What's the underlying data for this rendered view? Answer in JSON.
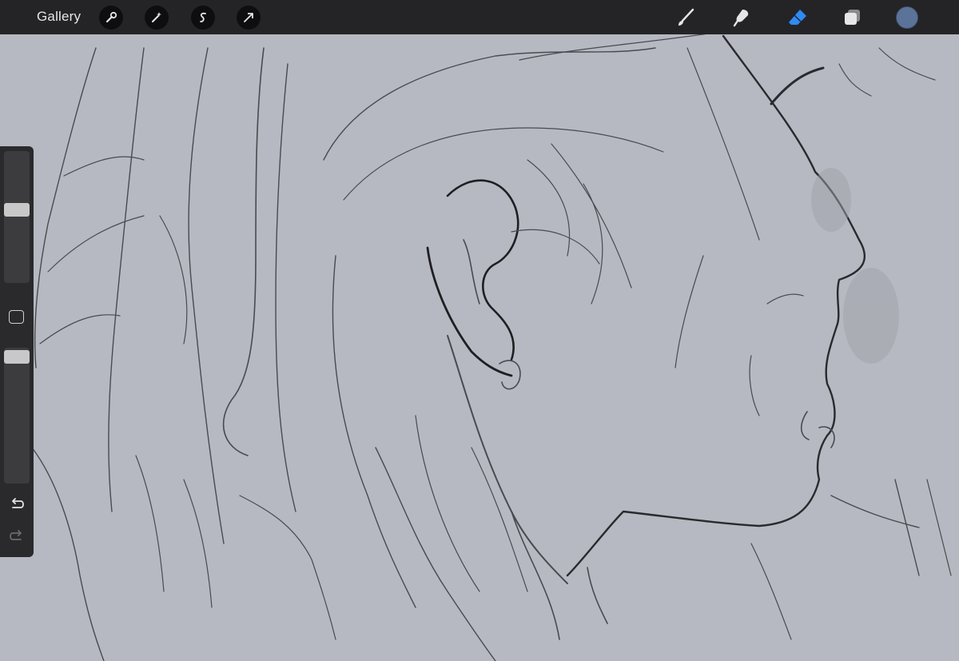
{
  "toolbar": {
    "gallery_label": "Gallery",
    "left_tools": [
      "actions-icon",
      "adjustments-icon",
      "selection-icon",
      "transform-icon"
    ],
    "right_tools": [
      "brush-icon",
      "smudge-icon",
      "eraser-icon",
      "layers-icon"
    ],
    "active_tool": "eraser-icon",
    "current_color": "#5c7399"
  },
  "sidebar": {
    "brush_size": 0.55,
    "brush_opacity": 0.95,
    "undo_icon": "undo-icon",
    "redo_icon": "redo-icon"
  },
  "colors": {
    "toolbar_bg": "#242426",
    "canvas_bg": "#b6b9c1",
    "accent_blue": "#2f8af5"
  }
}
